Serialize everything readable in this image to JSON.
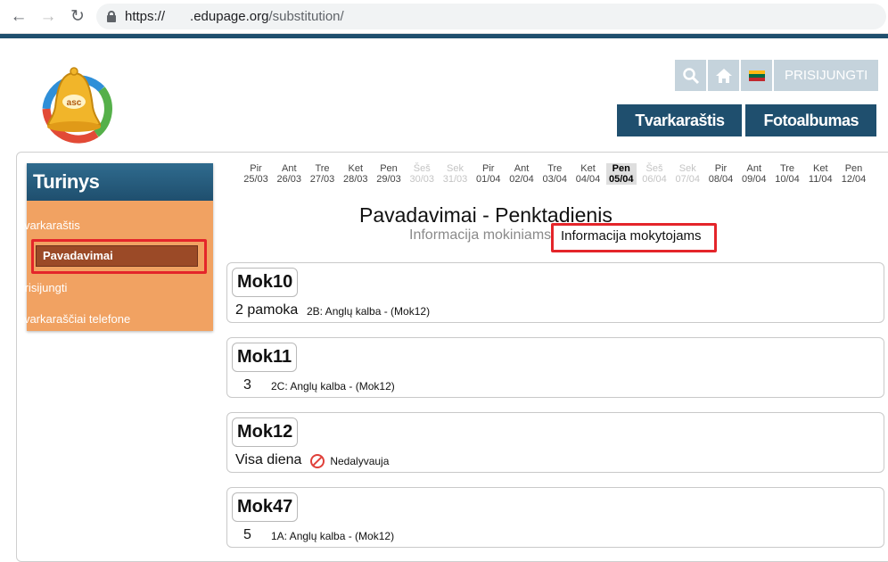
{
  "browser": {
    "url_prefix": "https://",
    "url_domain": ".edupage.org",
    "url_path": "/substitution/"
  },
  "header": {
    "login_label": "PRISIJUNGTI",
    "nav": [
      {
        "label": "Tvarkaraštis"
      },
      {
        "label": "Fotoalbumas"
      }
    ]
  },
  "sidebar": {
    "title": "Turinys",
    "items": [
      {
        "label": "Tvarkaraštis",
        "active": false
      },
      {
        "label": "Pavadavimai",
        "active": true
      },
      {
        "label": "Prisijungti",
        "active": false
      },
      {
        "label": "Tvarkaraščiai telefone",
        "active": false
      }
    ]
  },
  "dates": [
    {
      "day": "Pir",
      "date": "25/03",
      "state": "normal"
    },
    {
      "day": "Ant",
      "date": "26/03",
      "state": "normal"
    },
    {
      "day": "Tre",
      "date": "27/03",
      "state": "normal"
    },
    {
      "day": "Ket",
      "date": "28/03",
      "state": "normal"
    },
    {
      "day": "Pen",
      "date": "29/03",
      "state": "normal"
    },
    {
      "day": "Šeš",
      "date": "30/03",
      "state": "weekend"
    },
    {
      "day": "Sek",
      "date": "31/03",
      "state": "weekend"
    },
    {
      "day": "Pir",
      "date": "01/04",
      "state": "normal"
    },
    {
      "day": "Ant",
      "date": "02/04",
      "state": "normal"
    },
    {
      "day": "Tre",
      "date": "03/04",
      "state": "normal"
    },
    {
      "day": "Ket",
      "date": "04/04",
      "state": "normal"
    },
    {
      "day": "Pen",
      "date": "05/04",
      "state": "selected"
    },
    {
      "day": "Šeš",
      "date": "06/04",
      "state": "weekend"
    },
    {
      "day": "Sek",
      "date": "07/04",
      "state": "weekend"
    },
    {
      "day": "Pir",
      "date": "08/04",
      "state": "normal"
    },
    {
      "day": "Ant",
      "date": "09/04",
      "state": "normal"
    },
    {
      "day": "Tre",
      "date": "10/04",
      "state": "normal"
    },
    {
      "day": "Ket",
      "date": "11/04",
      "state": "normal"
    },
    {
      "day": "Pen",
      "date": "12/04",
      "state": "normal"
    }
  ],
  "main": {
    "title": "Pavadavimai - Penktadienis",
    "tab_students": "Informacija mokiniams",
    "tab_teachers": "Informacija mokytojams"
  },
  "cards": [
    {
      "name": "Mok10",
      "period": "2 pamoka",
      "desc": "2B: Anglų kalba - (Mok12)",
      "absent": false
    },
    {
      "name": "Mok11",
      "period": "3",
      "desc": "2C: Anglų kalba - (Mok12)",
      "absent": false
    },
    {
      "name": "Mok12",
      "period": "Visa diena",
      "desc": "Nedalyvauja",
      "absent": true
    },
    {
      "name": "Mok47",
      "period": "5",
      "desc": "1A: Anglų kalba - (Mok12)",
      "absent": false
    }
  ],
  "colors": {
    "brand_dark": "#1f4f6e",
    "sidebar_orange": "#f1a262",
    "active_item": "#9b4a27",
    "highlight_red": "#e4252a"
  }
}
